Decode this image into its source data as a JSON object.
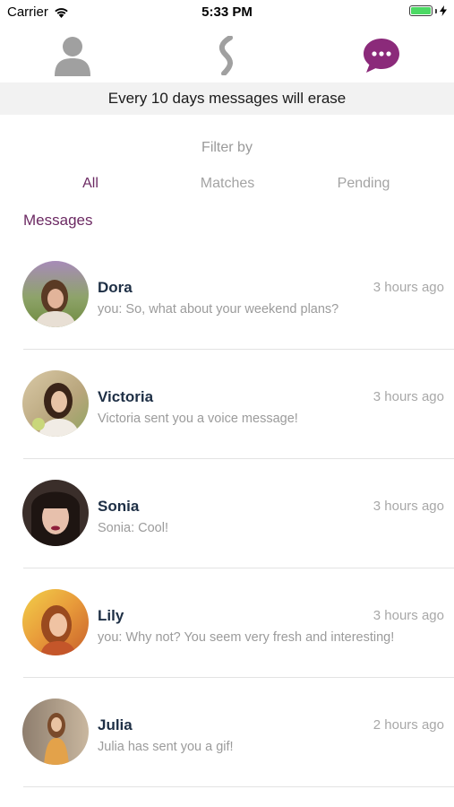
{
  "status_bar": {
    "carrier": "Carrier",
    "time": "5:33 PM",
    "battery_level": 1.0,
    "battery_color": "#4cd964"
  },
  "top_nav": [
    {
      "icon": "profile-icon",
      "color": "#a0a0a0"
    },
    {
      "icon": "logo-s-icon",
      "color": "#a0a0a0"
    },
    {
      "icon": "chat-bubble-icon",
      "color": "#8b2a7a",
      "active": true
    }
  ],
  "banner": {
    "text": "Every 10 days messages will erase"
  },
  "filter": {
    "title": "Filter by",
    "tabs": [
      {
        "label": "All",
        "active": true
      },
      {
        "label": "Matches",
        "active": false
      },
      {
        "label": "Pending",
        "active": false
      }
    ]
  },
  "section_title": "Messages",
  "accent_color": "#6c2a63",
  "messages": [
    {
      "name": "Dora",
      "time": "3 hours ago",
      "preview": "you: So, what about your weekend plans?",
      "avatar": "dora-photo"
    },
    {
      "name": "Victoria",
      "time": "3 hours ago",
      "preview": "Victoria sent you a voice message!",
      "avatar": "victoria-photo"
    },
    {
      "name": "Sonia",
      "time": "3 hours ago",
      "preview": "Sonia: Cool!",
      "avatar": "sonia-photo"
    },
    {
      "name": "Lily",
      "time": "3 hours ago",
      "preview": "you: Why not? You seem very fresh and interesting!",
      "avatar": "lily-photo"
    },
    {
      "name": "Julia",
      "time": "2 hours ago",
      "preview": "Julia has sent you a gif!",
      "avatar": "julia-photo"
    }
  ]
}
